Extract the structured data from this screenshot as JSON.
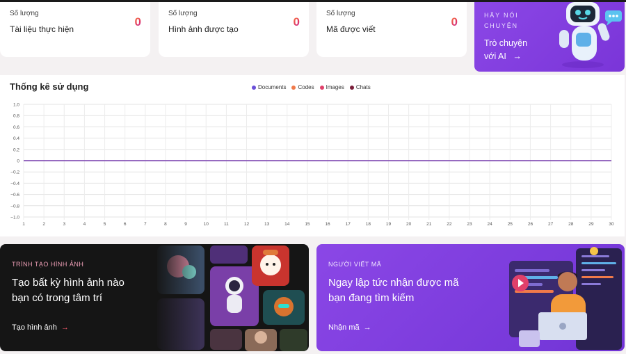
{
  "stats": [
    {
      "label": "Số lượng",
      "title": "Tài liệu thực hiện",
      "value": "0"
    },
    {
      "label": "Số lượng",
      "title": "Hình ảnh được tạo",
      "value": "0"
    },
    {
      "label": "Số lượng",
      "title": "Mã được viết",
      "value": "0"
    }
  ],
  "chat_promo": {
    "kicker": "HÃY NÓI CHUYỆN",
    "line1": "Trò chuyện",
    "line2": "với AI",
    "arrow": "→"
  },
  "usage": {
    "title": "Thống kê sử dụng"
  },
  "chart_data": {
    "type": "line",
    "title": "Thống kê sử dụng",
    "x": [
      1,
      2,
      3,
      4,
      5,
      6,
      7,
      8,
      9,
      10,
      11,
      12,
      13,
      14,
      15,
      16,
      17,
      18,
      19,
      20,
      21,
      22,
      23,
      24,
      25,
      26,
      27,
      28,
      29,
      30
    ],
    "ylim": [
      -1.0,
      1.0
    ],
    "y_ticks": [
      "1.0",
      "0.8",
      "0.6",
      "0.4",
      "0.2",
      "0",
      "−0.2",
      "−0.4",
      "−0.6",
      "−0.8",
      "−1.0"
    ],
    "grid": true,
    "legend_position": "top-center",
    "series": [
      {
        "name": "Documents",
        "color": "#6a4fd8",
        "values": [
          0,
          0,
          0,
          0,
          0,
          0,
          0,
          0,
          0,
          0,
          0,
          0,
          0,
          0,
          0,
          0,
          0,
          0,
          0,
          0,
          0,
          0,
          0,
          0,
          0,
          0,
          0,
          0,
          0,
          0
        ]
      },
      {
        "name": "Codes",
        "color": "#f07a4a",
        "values": [
          0,
          0,
          0,
          0,
          0,
          0,
          0,
          0,
          0,
          0,
          0,
          0,
          0,
          0,
          0,
          0,
          0,
          0,
          0,
          0,
          0,
          0,
          0,
          0,
          0,
          0,
          0,
          0,
          0,
          0
        ]
      },
      {
        "name": "Images",
        "color": "#e0406a",
        "values": [
          0,
          0,
          0,
          0,
          0,
          0,
          0,
          0,
          0,
          0,
          0,
          0,
          0,
          0,
          0,
          0,
          0,
          0,
          0,
          0,
          0,
          0,
          0,
          0,
          0,
          0,
          0,
          0,
          0,
          0
        ]
      },
      {
        "name": "Chats",
        "color": "#7a1f3a",
        "values": [
          0,
          0,
          0,
          0,
          0,
          0,
          0,
          0,
          0,
          0,
          0,
          0,
          0,
          0,
          0,
          0,
          0,
          0,
          0,
          0,
          0,
          0,
          0,
          0,
          0,
          0,
          0,
          0,
          0,
          0
        ]
      }
    ]
  },
  "image_banner": {
    "kicker": "TRÌNH TẠO HÌNH ẢNH",
    "headline": "Tạo bất kỳ hình ảnh nào bạn có trong tâm trí",
    "link": "Tạo hình ảnh",
    "arrow": "→"
  },
  "code_banner": {
    "kicker": "NGƯỜI VIẾT MÃ",
    "headline": "Ngay lập tức nhận được mã bạn đang tìm kiếm",
    "link": "Nhận mã",
    "arrow": "→"
  }
}
